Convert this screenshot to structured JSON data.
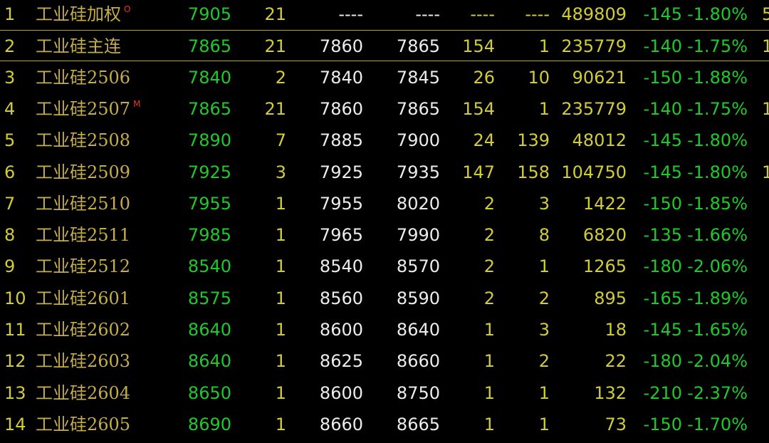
{
  "quotes": [
    {
      "idx": "1",
      "name": "工业硅加权",
      "mark": "O",
      "last": "7905",
      "vol": "21",
      "bid": "----",
      "ask": "----",
      "bidv": "----",
      "askv": "----",
      "oi": "489809",
      "chg": "-145",
      "pct": "-1.80%",
      "extra": "5"
    },
    {
      "idx": "2",
      "name": "工业硅主连",
      "mark": "",
      "last": "7865",
      "vol": "21",
      "bid": "7860",
      "ask": "7865",
      "bidv": "154",
      "askv": "1",
      "oi": "235779",
      "chg": "-140",
      "pct": "-1.75%",
      "extra": "1"
    },
    {
      "idx": "3",
      "name": "工业硅2506",
      "mark": "",
      "last": "7840",
      "vol": "2",
      "bid": "7840",
      "ask": "7845",
      "bidv": "26",
      "askv": "10",
      "oi": "90621",
      "chg": "-150",
      "pct": "-1.88%",
      "extra": ""
    },
    {
      "idx": "4",
      "name": "工业硅2507",
      "mark": "M",
      "last": "7865",
      "vol": "21",
      "bid": "7860",
      "ask": "7865",
      "bidv": "154",
      "askv": "1",
      "oi": "235779",
      "chg": "-140",
      "pct": "-1.75%",
      "extra": "1"
    },
    {
      "idx": "5",
      "name": "工业硅2508",
      "mark": "",
      "last": "7890",
      "vol": "7",
      "bid": "7885",
      "ask": "7900",
      "bidv": "24",
      "askv": "139",
      "oi": "48012",
      "chg": "-145",
      "pct": "-1.80%",
      "extra": ""
    },
    {
      "idx": "6",
      "name": "工业硅2509",
      "mark": "",
      "last": "7925",
      "vol": "3",
      "bid": "7925",
      "ask": "7935",
      "bidv": "147",
      "askv": "158",
      "oi": "104750",
      "chg": "-145",
      "pct": "-1.80%",
      "extra": "1"
    },
    {
      "idx": "7",
      "name": "工业硅2510",
      "mark": "",
      "last": "7955",
      "vol": "1",
      "bid": "7955",
      "ask": "8020",
      "bidv": "2",
      "askv": "3",
      "oi": "1422",
      "chg": "-150",
      "pct": "-1.85%",
      "extra": ""
    },
    {
      "idx": "8",
      "name": "工业硅2511",
      "mark": "",
      "last": "7985",
      "vol": "1",
      "bid": "7965",
      "ask": "7990",
      "bidv": "2",
      "askv": "8",
      "oi": "6820",
      "chg": "-135",
      "pct": "-1.66%",
      "extra": ""
    },
    {
      "idx": "9",
      "name": "工业硅2512",
      "mark": "",
      "last": "8540",
      "vol": "1",
      "bid": "8540",
      "ask": "8570",
      "bidv": "2",
      "askv": "1",
      "oi": "1265",
      "chg": "-180",
      "pct": "-2.06%",
      "extra": ""
    },
    {
      "idx": "10",
      "name": "工业硅2601",
      "mark": "",
      "last": "8575",
      "vol": "1",
      "bid": "8560",
      "ask": "8590",
      "bidv": "2",
      "askv": "2",
      "oi": "895",
      "chg": "-165",
      "pct": "-1.89%",
      "extra": ""
    },
    {
      "idx": "11",
      "name": "工业硅2602",
      "mark": "",
      "last": "8640",
      "vol": "1",
      "bid": "8600",
      "ask": "8640",
      "bidv": "1",
      "askv": "3",
      "oi": "18",
      "chg": "-145",
      "pct": "-1.65%",
      "extra": ""
    },
    {
      "idx": "12",
      "name": "工业硅2603",
      "mark": "",
      "last": "8640",
      "vol": "1",
      "bid": "8625",
      "ask": "8660",
      "bidv": "1",
      "askv": "2",
      "oi": "22",
      "chg": "-180",
      "pct": "-2.04%",
      "extra": ""
    },
    {
      "idx": "13",
      "name": "工业硅2604",
      "mark": "",
      "last": "8650",
      "vol": "1",
      "bid": "8600",
      "ask": "8750",
      "bidv": "1",
      "askv": "1",
      "oi": "132",
      "chg": "-210",
      "pct": "-2.37%",
      "extra": ""
    },
    {
      "idx": "14",
      "name": "工业硅2605",
      "mark": "",
      "last": "8690",
      "vol": "1",
      "bid": "8660",
      "ask": "8665",
      "bidv": "1",
      "askv": "1",
      "oi": "73",
      "chg": "-150",
      "pct": "-1.70%",
      "extra": ""
    }
  ],
  "selected_index": 1,
  "colors": {
    "background": "#000000",
    "index": "#d2cc3a",
    "name": "#c4ad4a",
    "down": "#20c92b",
    "neutral": "#ececec",
    "volume": "#d2cc3a",
    "mark": "#e23a2a",
    "selection_line": "#b8a52a"
  }
}
